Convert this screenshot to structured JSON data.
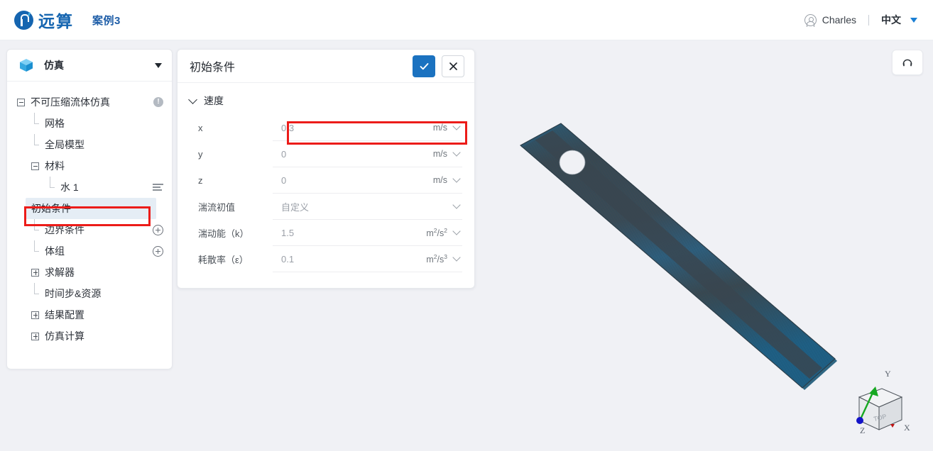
{
  "header": {
    "logo_icon": "yuansuan-logo-icon",
    "logo_text": "远算",
    "case_title": "案例3",
    "avatar_icon": "user-avatar-icon",
    "user_name": "Charles",
    "language": "中文",
    "language_caret_icon": "caret-down-icon"
  },
  "sidebar": {
    "header": {
      "icon": "cube-icon",
      "label": "仿真",
      "caret_icon": "caret-down-icon"
    },
    "tree": [
      {
        "label": "不可压缩流体仿真",
        "expander": "minus",
        "indent": 0,
        "trailing_icon": "info-badge",
        "trailing_text": "!",
        "selected": false
      },
      {
        "label": "网格",
        "expander": "elbow",
        "indent": 1,
        "trailing_icon": "",
        "trailing_text": "",
        "selected": false
      },
      {
        "label": "全局模型",
        "expander": "elbow",
        "indent": 1,
        "trailing_icon": "",
        "trailing_text": "",
        "selected": false
      },
      {
        "label": "材料",
        "expander": "minus",
        "indent": 1,
        "trailing_icon": "",
        "trailing_text": "",
        "selected": false
      },
      {
        "label": "水 1",
        "expander": "elbow",
        "indent": 2,
        "trailing_icon": "list-icon",
        "trailing_text": "",
        "selected": false
      },
      {
        "label": "初始条件",
        "expander": "elbow",
        "indent": 1,
        "trailing_icon": "",
        "trailing_text": "",
        "selected": true
      },
      {
        "label": "边界条件",
        "expander": "elbow",
        "indent": 1,
        "trailing_icon": "plus-circle-icon",
        "trailing_text": "",
        "selected": false
      },
      {
        "label": "体组",
        "expander": "elbow",
        "indent": 1,
        "trailing_icon": "plus-circle-icon",
        "trailing_text": "",
        "selected": false
      },
      {
        "label": "求解器",
        "expander": "plus",
        "indent": 1,
        "trailing_icon": "",
        "trailing_text": "",
        "selected": false
      },
      {
        "label": "时间步&资源",
        "expander": "elbow",
        "indent": 1,
        "trailing_icon": "",
        "trailing_text": "",
        "selected": false
      },
      {
        "label": "结果配置",
        "expander": "plus",
        "indent": 1,
        "trailing_icon": "",
        "trailing_text": "",
        "selected": false
      },
      {
        "label": "仿真计算",
        "expander": "plus",
        "indent": 1,
        "trailing_icon": "",
        "trailing_text": "",
        "selected": false
      }
    ]
  },
  "form": {
    "title": "初始条件",
    "confirm_icon": "check-icon",
    "close_icon": "close-icon",
    "section": {
      "caret_icon": "chevron-down-icon",
      "label": "速度"
    },
    "fields": [
      {
        "label": "x",
        "value": "0.3",
        "unit": "m/s",
        "unit_sup": "",
        "unit_sub": "",
        "has_unit_caret": true,
        "highlighted": true
      },
      {
        "label": "y",
        "value": "0",
        "unit": "m/s",
        "unit_sup": "",
        "unit_sub": "",
        "has_unit_caret": true,
        "highlighted": false
      },
      {
        "label": "z",
        "value": "0",
        "unit": "m/s",
        "unit_sup": "",
        "unit_sub": "",
        "has_unit_caret": true,
        "highlighted": false
      },
      {
        "label": "湍流初值",
        "value": "自定义",
        "unit": "",
        "unit_sup": "",
        "unit_sub": "",
        "has_unit_caret": true,
        "highlighted": false
      },
      {
        "label": "湍动能（k）",
        "value": "1.5",
        "unit": "m/s",
        "unit_sup": "2",
        "unit_sub": "2",
        "has_unit_caret": true,
        "highlighted": false
      },
      {
        "label": "耗散率（ε）",
        "value": "0.1",
        "unit": "m/s",
        "unit_sup": "2",
        "unit_sub": "3",
        "has_unit_caret": true,
        "highlighted": false
      }
    ]
  },
  "viewport": {
    "reset_icon": "rotate-reset-icon",
    "model": {
      "name": "plate-with-hole-mesh",
      "body_color": "#37434d",
      "mesh_color": "#1d5f80"
    },
    "axis_widget": {
      "cube_face_label": "TOP",
      "x_label": "X",
      "y_label": "Y",
      "z_label": "Z",
      "y_axis_color": "#16a821",
      "z_axis_color": "#1313c8",
      "x_axis_color": "#c01414"
    }
  },
  "annotations": {
    "tree_highlight": "初始条件",
    "field_highlight": "x"
  },
  "colors": {
    "brand_blue": "#1565b0",
    "accent_blue": "#1b72c0",
    "annotation_red": "#ec1c19",
    "selected_row_bg": "#e5edf5",
    "viewport_bg": "#f0f1f5"
  }
}
